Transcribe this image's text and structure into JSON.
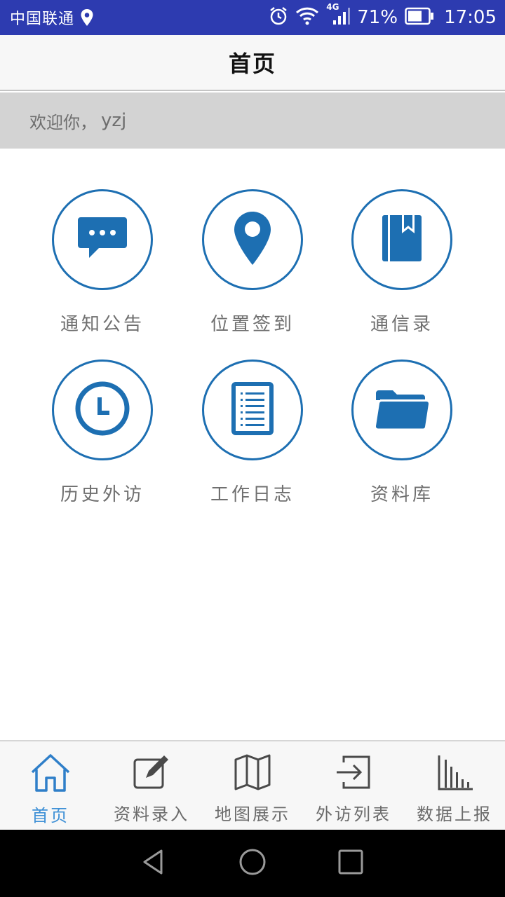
{
  "status_bar": {
    "carrier": "中国联通",
    "network": "4G",
    "battery": "71%",
    "time": "17:05"
  },
  "header": {
    "title": "首页"
  },
  "welcome": {
    "greeting": "欢迎你，",
    "username": "yzj"
  },
  "menu": {
    "items": [
      {
        "label": "通知公告",
        "icon": "message-icon"
      },
      {
        "label": "位置签到",
        "icon": "location-pin-icon"
      },
      {
        "label": "通信录",
        "icon": "contact-book-icon"
      },
      {
        "label": "历史外访",
        "icon": "clock-icon"
      },
      {
        "label": "工作日志",
        "icon": "document-icon"
      },
      {
        "label": "资料库",
        "icon": "folder-icon"
      }
    ]
  },
  "bottom_nav": {
    "items": [
      {
        "label": "首页",
        "icon": "home-icon",
        "active": true
      },
      {
        "label": "资料录入",
        "icon": "edit-icon",
        "active": false
      },
      {
        "label": "地图展示",
        "icon": "map-icon",
        "active": false
      },
      {
        "label": "外访列表",
        "icon": "login-icon",
        "active": false
      },
      {
        "label": "数据上报",
        "icon": "bar-chart-icon",
        "active": false
      }
    ]
  },
  "colors": {
    "status_bar": "#2d3bb0",
    "accent": "#1d6fb2",
    "active_tab": "#3e90d6"
  }
}
